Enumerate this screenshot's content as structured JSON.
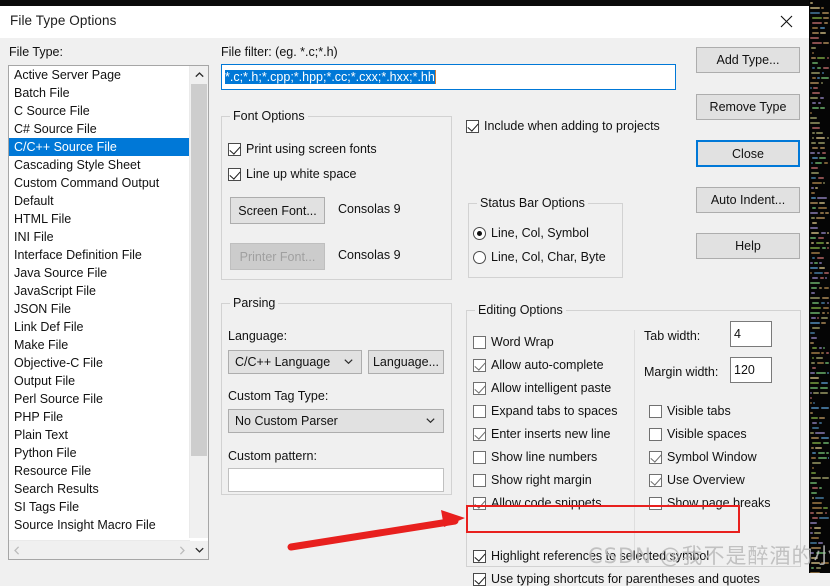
{
  "window": {
    "title": "File Type Options",
    "close_icon": "close-icon"
  },
  "file_type": {
    "label": "File Type:",
    "items": [
      "Active Server Page",
      "Batch File",
      "C Source File",
      "C# Source File",
      "C/C++ Source File",
      "Cascading Style Sheet",
      "Custom Command Output",
      "Default",
      "HTML File",
      "INI File",
      "Interface Definition File",
      "Java Source File",
      "JavaScript File",
      "JSON File",
      "Link Def File",
      "Make File",
      "Objective-C File",
      "Output File",
      "Perl Source File",
      "PHP File",
      "Plain Text",
      "Python File",
      "Resource File",
      "Search Results",
      "SI Tags File",
      "Source Insight Macro File"
    ],
    "selected": "C/C++ Source File",
    "selected_index": 4,
    "scroll_up_icon": "chevron-up-icon",
    "scroll_down_icon": "chevron-down-icon",
    "scroll_left_icon": "chevron-left-icon",
    "scroll_right_icon": "chevron-right-icon"
  },
  "file_filter": {
    "label": "File filter: (eg. *.c;*.h)",
    "value": "*.c;*.h;*.cpp;*.hpp;*.cc;*.cxx;*.hxx;*.hh",
    "selected": true
  },
  "font_options": {
    "legend": "Font Options",
    "print_using_screen_fonts": {
      "label": "Print using screen fonts",
      "checked": true
    },
    "line_up_white_space": {
      "label": "Line up white space",
      "checked": true
    },
    "screen_font_button": {
      "label": "Screen Font...",
      "disabled": false
    },
    "screen_font_value": "Consolas 9",
    "printer_font_button": {
      "label": "Printer Font...",
      "disabled": true
    },
    "printer_font_value": "Consolas 9"
  },
  "include_when_adding": {
    "label": "Include when adding to projects",
    "checked": true
  },
  "status_bar_options": {
    "legend": "Status Bar Options",
    "options": [
      {
        "label": "Line, Col, Symbol",
        "selected": true
      },
      {
        "label": "Line, Col, Char, Byte",
        "selected": false
      }
    ]
  },
  "parsing": {
    "legend": "Parsing",
    "language_label": "Language:",
    "language_value": "C/C++ Language",
    "language_button": "Language...",
    "custom_tag_label": "Custom Tag Type:",
    "custom_tag_value": "No Custom Parser",
    "custom_pattern_label": "Custom pattern:",
    "custom_pattern_value": ""
  },
  "editing_options": {
    "legend": "Editing Options",
    "left_checks": [
      {
        "label": "Word Wrap",
        "checked": false
      },
      {
        "label": "Allow auto-complete",
        "checked": true
      },
      {
        "label": "Allow intelligent paste",
        "checked": true
      },
      {
        "label": "Expand tabs to spaces",
        "checked": false
      },
      {
        "label": "Enter inserts new line",
        "checked": true
      },
      {
        "label": "Show line numbers",
        "checked": false
      },
      {
        "label": "Show right margin",
        "checked": false
      },
      {
        "label": "Allow code snippets",
        "checked": true
      }
    ],
    "highlighted_check": {
      "label": "Highlight references to selected symbol",
      "checked": true
    },
    "bottom_check": {
      "label": "Use typing shortcuts for parentheses and quotes",
      "checked": true
    },
    "tab_width_label": "Tab width:",
    "tab_width_value": "4",
    "margin_width_label": "Margin width:",
    "margin_width_value": "120",
    "right_checks": [
      {
        "label": "Visible tabs",
        "checked": false
      },
      {
        "label": "Visible spaces",
        "checked": false
      },
      {
        "label": "Symbol Window",
        "checked": true
      },
      {
        "label": "Use Overview",
        "checked": true
      },
      {
        "label": "Show page breaks",
        "checked": false
      }
    ]
  },
  "buttons": {
    "add_type": "Add Type...",
    "remove_type": "Remove Type",
    "close": "Close",
    "auto_indent": "Auto Indent...",
    "help": "Help"
  },
  "annotation": {
    "highlight_color": "#e8201e",
    "arrow_icon": "red-arrow-annotation"
  },
  "watermark": "CSDN @我不是醉酒的小熊~",
  "colors": {
    "accent": "#0078d7",
    "dialog_bg": "#f0f0f0",
    "annotation_red": "#e8201e"
  }
}
